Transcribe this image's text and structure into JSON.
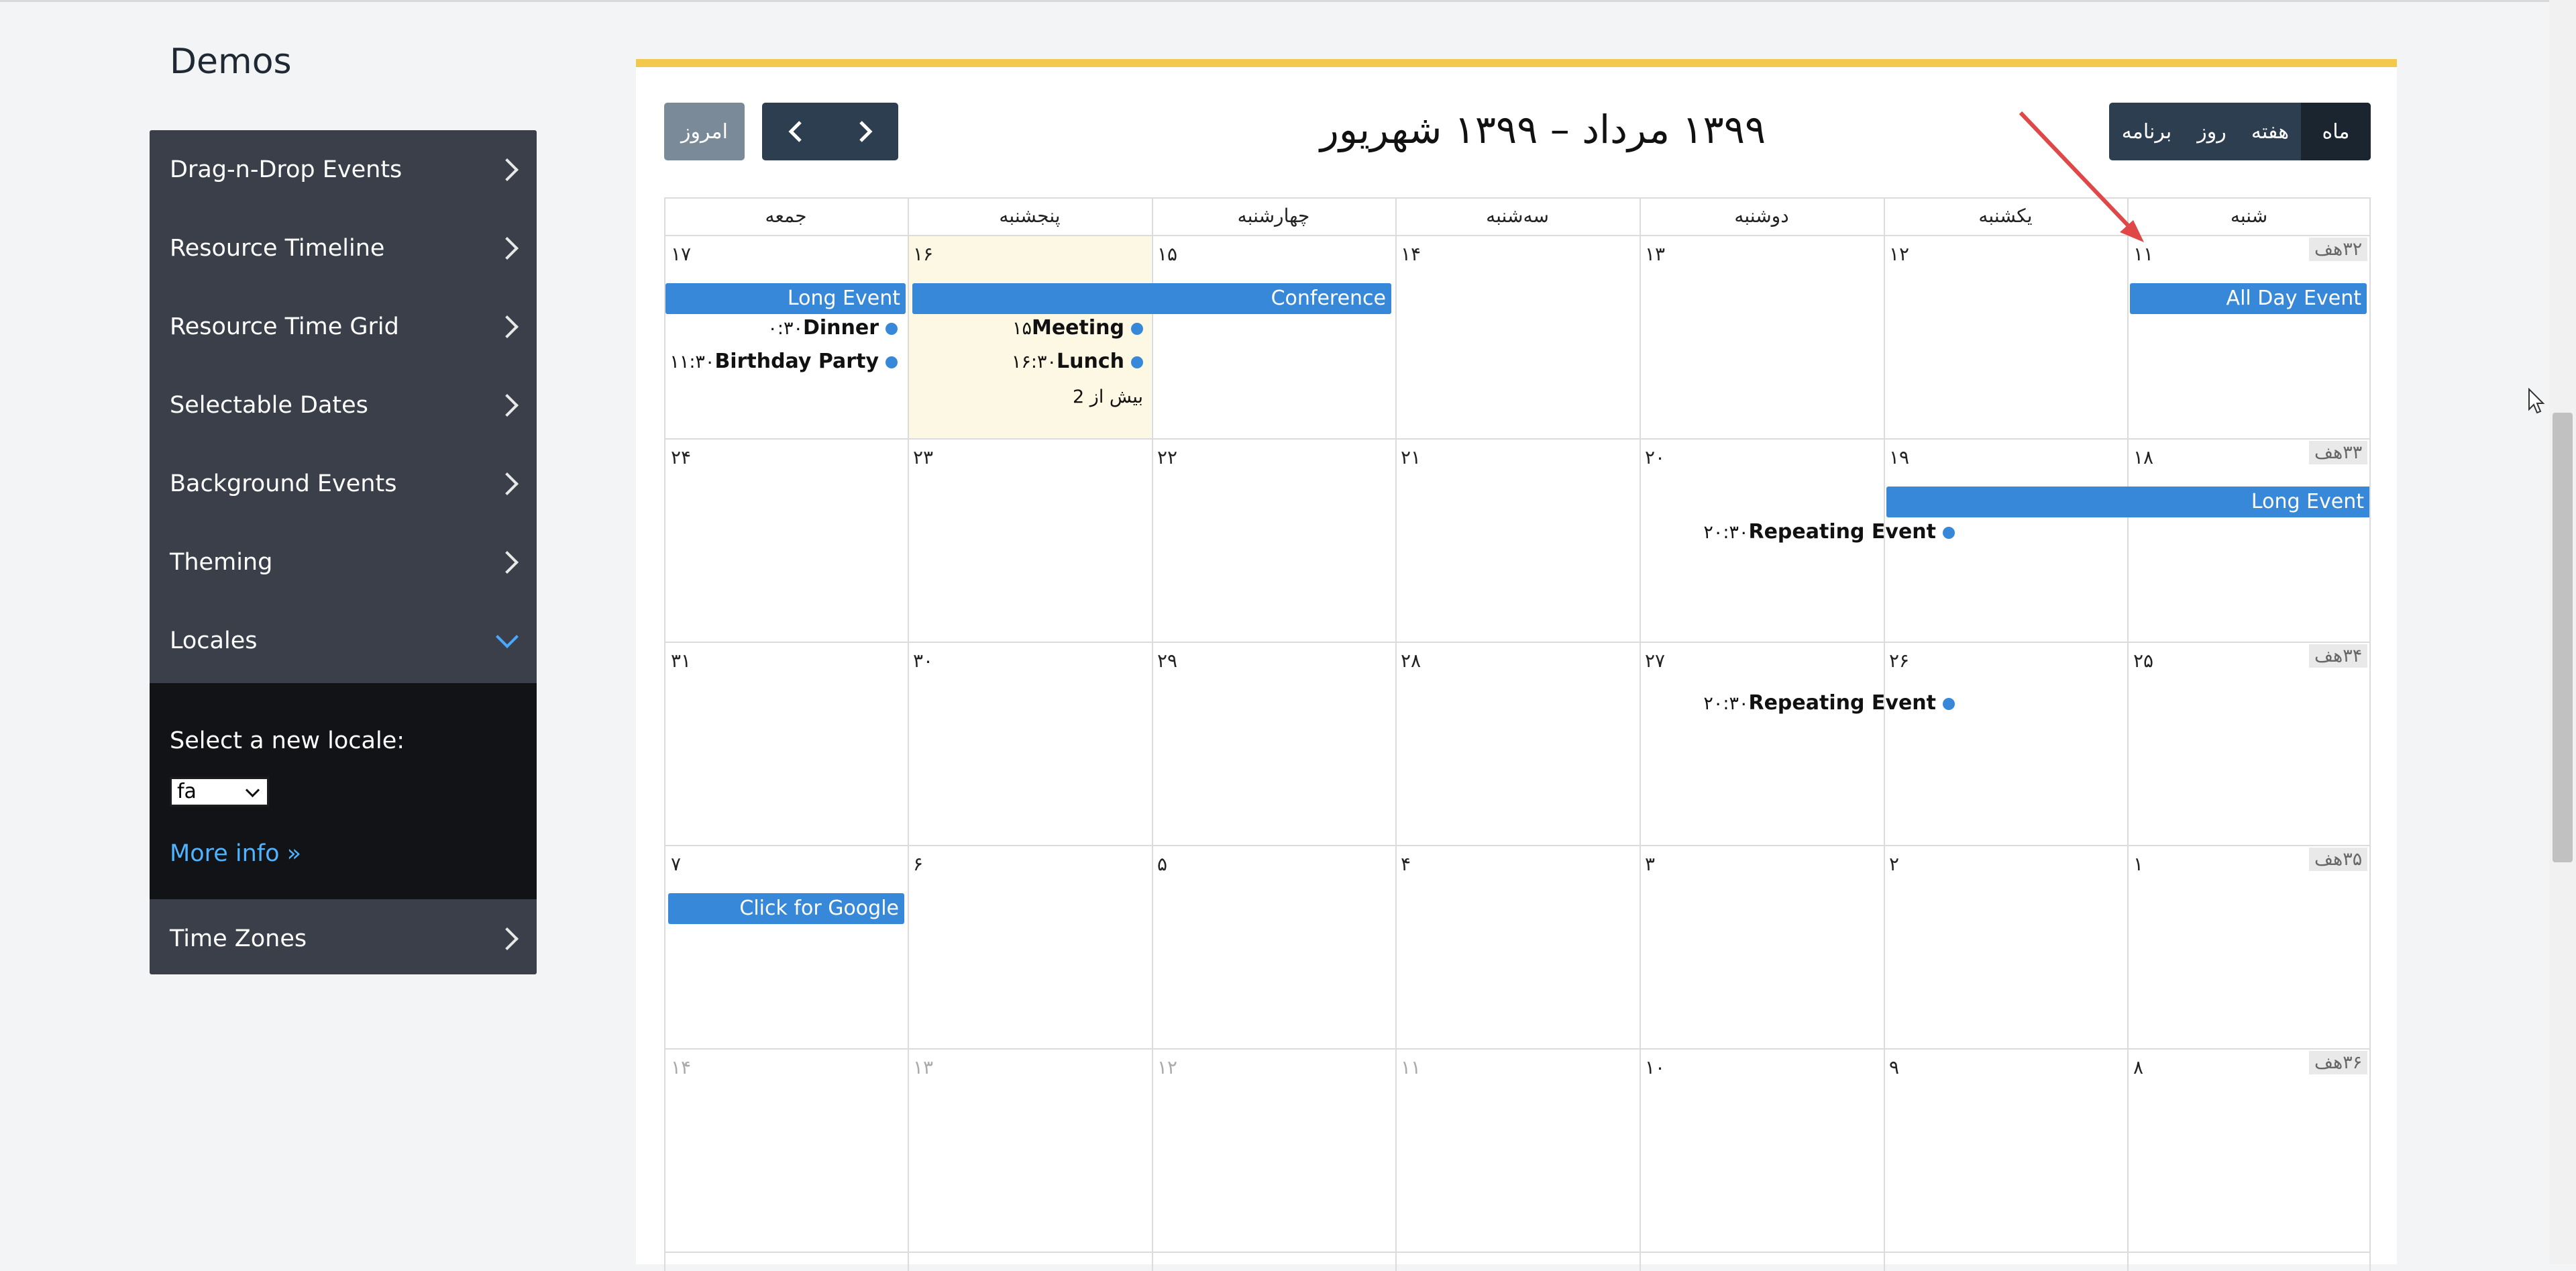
{
  "brand": "Demos",
  "sidebar": {
    "items": [
      {
        "label": "Drag-n-Drop Events"
      },
      {
        "label": "Resource Timeline"
      },
      {
        "label": "Resource Time Grid"
      },
      {
        "label": "Selectable Dates"
      },
      {
        "label": "Background Events"
      },
      {
        "label": "Theming"
      },
      {
        "label": "Locales"
      },
      {
        "label": "Time Zones"
      }
    ],
    "locale": {
      "label": "Select a new locale:",
      "selected": "fa",
      "more_info": "More info »"
    }
  },
  "toolbar": {
    "today": "امروز",
    "prev_icon": "chevron-left-icon",
    "next_icon": "chevron-right-icon",
    "title": "۱۳۹۹ مرداد – ۱۳۹۹ شهریور",
    "views": {
      "month": "ماه",
      "week": "هفته",
      "day": "روز",
      "list": "برنامه"
    },
    "active_view": "month"
  },
  "calendar": {
    "day_headers": [
      "شنبه",
      "یکشنبه",
      "دوشنبه",
      "سه‌شنبه",
      "چهارشنبه",
      "پنجشنبه",
      "جمعه"
    ],
    "weeks": [
      {
        "week": "۳۲هف",
        "days": [
          "۱۱",
          "۱۲",
          "۱۳",
          "۱۴",
          "۱۵",
          "۱۶",
          "۱۷"
        ]
      },
      {
        "week": "۳۳هف",
        "days": [
          "۱۸",
          "۱۹",
          "۲۰",
          "۲۱",
          "۲۲",
          "۲۳",
          "۲۴"
        ]
      },
      {
        "week": "۳۴هف",
        "days": [
          "۲۵",
          "۲۶",
          "۲۷",
          "۲۸",
          "۲۹",
          "۳۰",
          "۳۱"
        ]
      },
      {
        "week": "۳۵هف",
        "days": [
          "۱",
          "۲",
          "۳",
          "۴",
          "۵",
          "۶",
          "۷"
        ]
      },
      {
        "week": "۳۶هف",
        "days": [
          "۸",
          "۹",
          "۱۰",
          "۱۱",
          "۱۲",
          "۱۳",
          "۱۴"
        ]
      }
    ],
    "events": {
      "all_day": "All Day Event",
      "long_event_1": "Long Event",
      "conference": "Conference",
      "meeting": {
        "time": "۱۵",
        "name": "Meeting"
      },
      "lunch": {
        "time": "۱۶:۳۰",
        "name": "Lunch"
      },
      "dinner": {
        "time": "۰:۳۰",
        "name": "Dinner"
      },
      "birthday": {
        "time": "۱۱:۳۰",
        "name": "Birthday Party"
      },
      "more_link": "بیش از 2",
      "long_event_2": "Long Event",
      "repeating_1": {
        "time": "۲۰:۳۰",
        "name": "Repeating Event"
      },
      "repeating_2": {
        "time": "۲۰:۳۰",
        "name": "Repeating Event"
      },
      "google": "Click for Google"
    }
  },
  "colors": {
    "event": "#3788d8",
    "today_bg": "#fcf8e3",
    "accent_border": "#f2c94c",
    "sidebar_bg": "#3a3f4a",
    "button_dark": "#2c3e50",
    "annotation_arrow": "#e04848"
  }
}
